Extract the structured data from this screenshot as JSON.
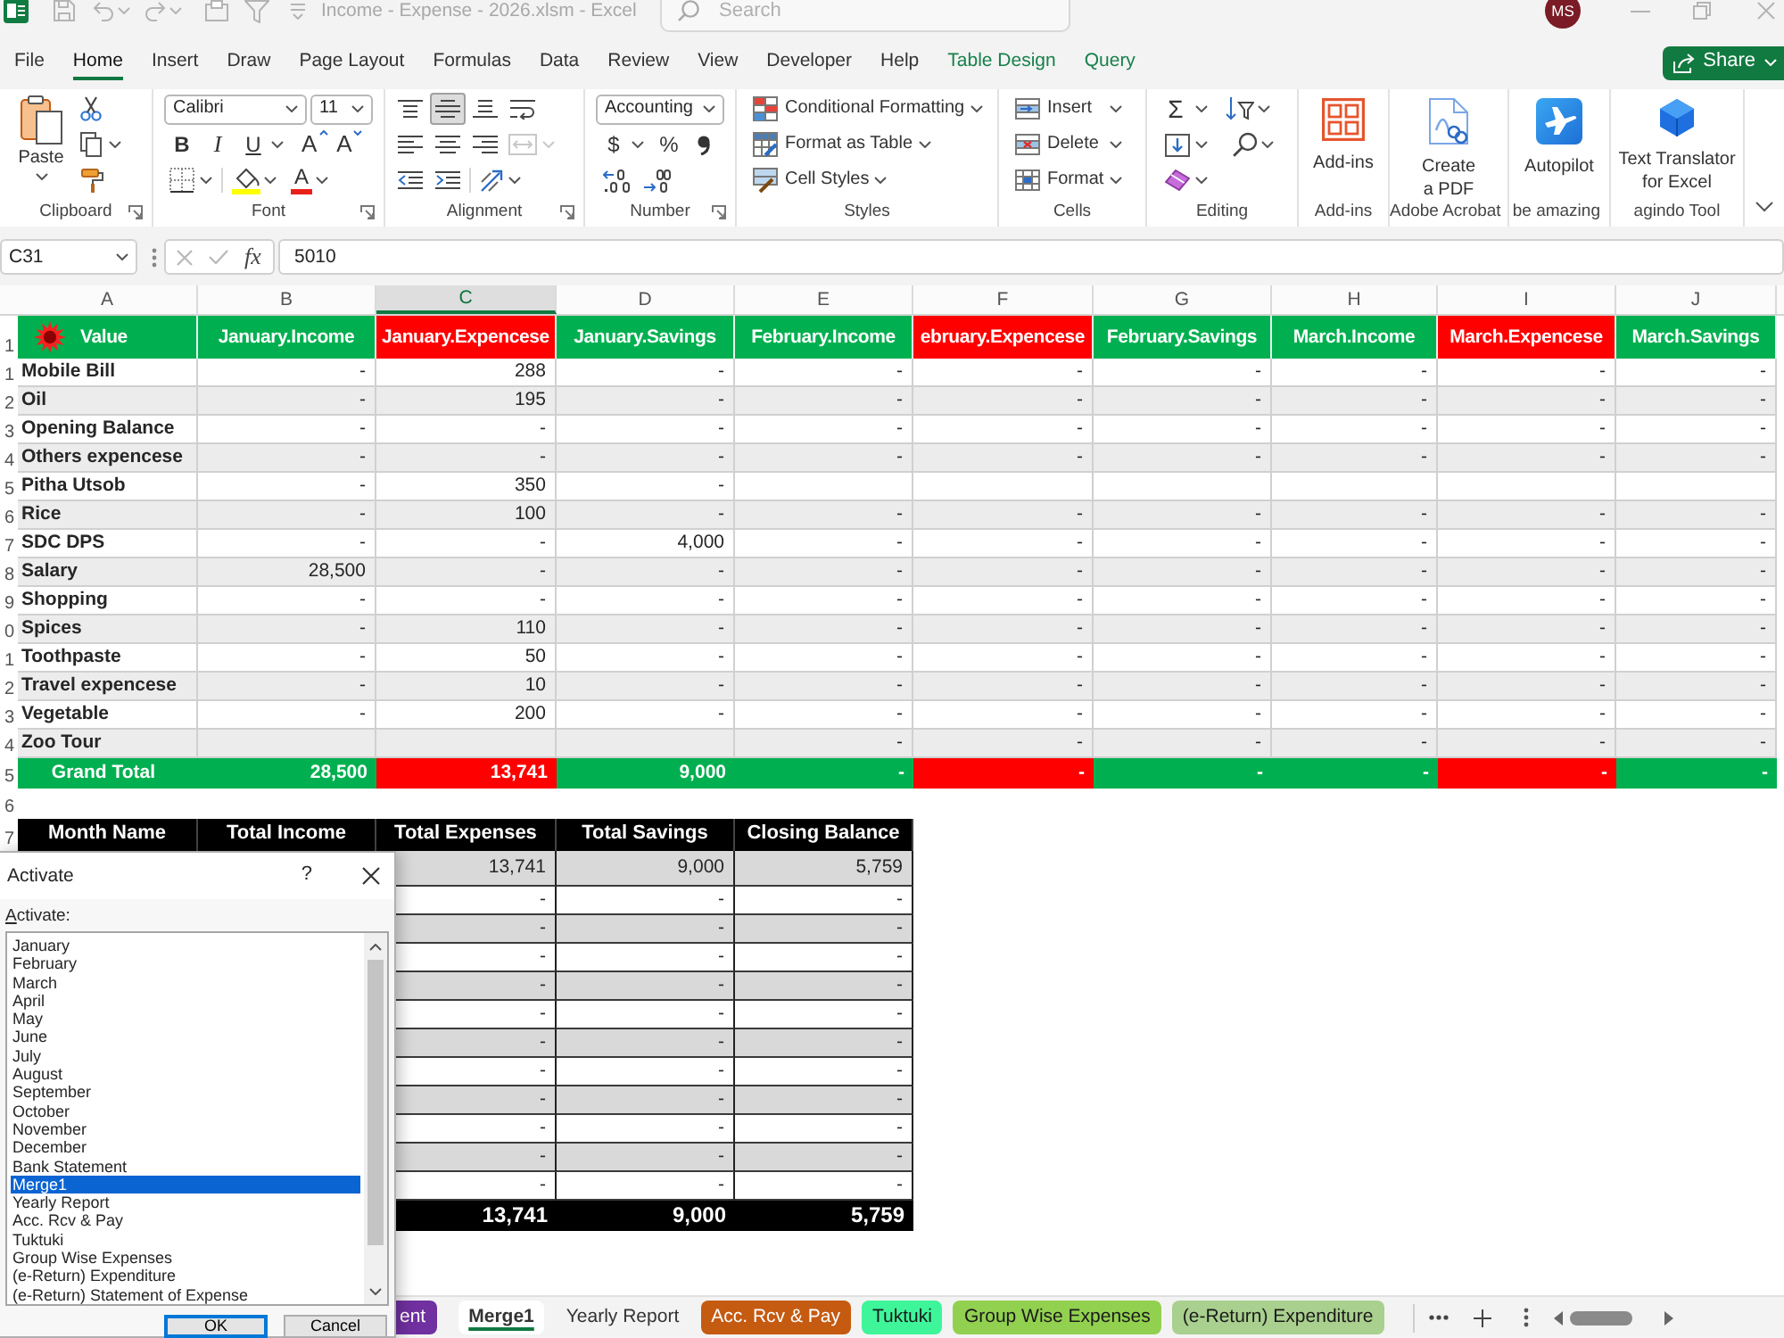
{
  "title_bar": {
    "title": "Income - Expense - 2026.xlsm - Excel",
    "search": {
      "placeholder": "Search"
    },
    "avatar": "MS"
  },
  "menu": {
    "tabs": [
      {
        "label": "File",
        "selected": false,
        "kind": "standard"
      },
      {
        "label": "Home",
        "selected": true,
        "kind": "standard"
      },
      {
        "label": "Insert",
        "selected": false,
        "kind": "standard"
      },
      {
        "label": "Draw",
        "selected": false,
        "kind": "standard"
      },
      {
        "label": "Page Layout",
        "selected": false,
        "kind": "standard"
      },
      {
        "label": "Formulas",
        "selected": false,
        "kind": "standard"
      },
      {
        "label": "Data",
        "selected": false,
        "kind": "standard"
      },
      {
        "label": "Review",
        "selected": false,
        "kind": "standard"
      },
      {
        "label": "View",
        "selected": false,
        "kind": "standard"
      },
      {
        "label": "Developer",
        "selected": false,
        "kind": "standard"
      },
      {
        "label": "Help",
        "selected": false,
        "kind": "standard"
      },
      {
        "label": "Table Design",
        "selected": false,
        "kind": "contextual"
      },
      {
        "label": "Query",
        "selected": false,
        "kind": "contextual"
      }
    ],
    "share": "Share"
  },
  "ribbon": {
    "groups": [
      {
        "label": "Clipboard",
        "launcher": true
      },
      {
        "label": "Font",
        "launcher": true
      },
      {
        "label": "Alignment",
        "launcher": true
      },
      {
        "label": "Number",
        "launcher": true
      },
      {
        "label": "Styles",
        "launcher": false
      },
      {
        "label": "Cells",
        "launcher": false
      },
      {
        "label": "Editing",
        "launcher": false
      },
      {
        "label": "Add-ins",
        "launcher": false
      },
      {
        "label": "Adobe Acrobat",
        "launcher": false
      },
      {
        "label": "be amazing",
        "launcher": false
      },
      {
        "label": "agindo Tool",
        "launcher": false
      }
    ],
    "paste": "Paste",
    "font_name": "Calibri",
    "font_size": "11",
    "bold": "B",
    "italic": "I",
    "underline": "U",
    "grow_font": "A",
    "shrink_font": "A",
    "font_color": "A",
    "vertical_align": [
      {
        "selected": false
      },
      {
        "selected": true
      },
      {
        "selected": false
      }
    ],
    "merge_disabled": true,
    "number_format": "Accounting",
    "currency": "$",
    "percent": "%",
    "style_commands": [
      "Conditional Formatting",
      "Format as Table",
      "Cell Styles"
    ],
    "cell_commands": [
      "Insert",
      "Delete",
      "Format"
    ],
    "autosum": "Σ",
    "large_buttons": [
      "Add-ins",
      "Create a PDF",
      "Autopilot",
      "Text Translator for Excel"
    ]
  },
  "formula_bar": {
    "name_box": "C31",
    "fx": "fx",
    "formula": "5010"
  },
  "sheet": {
    "columns": [
      {
        "letter": "A",
        "selected": false
      },
      {
        "letter": "B",
        "selected": false
      },
      {
        "letter": "C",
        "selected": true
      },
      {
        "letter": "D",
        "selected": false
      },
      {
        "letter": "E",
        "selected": false
      },
      {
        "letter": "F",
        "selected": false
      },
      {
        "letter": "G",
        "selected": false
      },
      {
        "letter": "H",
        "selected": false
      },
      {
        "letter": "I",
        "selected": false
      },
      {
        "letter": "J",
        "selected": false
      }
    ],
    "header_row": {
      "row_number": "1",
      "cells": [
        {
          "text": "Value",
          "color": "#00b050"
        },
        {
          "text": "January.Income",
          "color": "#00b050"
        },
        {
          "text": "January.Expencese",
          "color": "#ff0000"
        },
        {
          "text": "January.Savings",
          "color": "#00b050"
        },
        {
          "text": "February.Income",
          "color": "#00b050"
        },
        {
          "text": "ebruary.Expencese",
          "color": "#ff0000"
        },
        {
          "text": "February.Savings",
          "color": "#00b050"
        },
        {
          "text": "March.Income",
          "color": "#00b050"
        },
        {
          "text": "March.Expencese",
          "color": "#ff0000"
        },
        {
          "text": "March.Savings",
          "color": "#00b050"
        }
      ]
    },
    "rows": [
      {
        "row_number": "1",
        "label": "Mobile Bill",
        "kind": "full",
        "values": [
          "-",
          "288",
          "-",
          "-",
          "-",
          "-",
          "-",
          "-",
          "-"
        ]
      },
      {
        "row_number": "2",
        "label": "Oil",
        "kind": "full",
        "values": [
          "-",
          "195",
          "-",
          "-",
          "-",
          "-",
          "-",
          "-",
          "-"
        ]
      },
      {
        "row_number": "3",
        "label": "Opening Balance",
        "kind": "full",
        "values": [
          "-",
          "-",
          "-",
          "-",
          "-",
          "-",
          "-",
          "-",
          "-"
        ]
      },
      {
        "row_number": "4",
        "label": "Others expencese",
        "kind": "full",
        "values": [
          "-",
          "-",
          "-",
          "-",
          "-",
          "-",
          "-",
          "-",
          "-"
        ]
      },
      {
        "row_number": "5",
        "label": "Pitha Utsob",
        "kind": "leading",
        "values": [
          "-",
          "350",
          "-"
        ]
      },
      {
        "row_number": "6",
        "label": "Rice",
        "kind": "full",
        "values": [
          "-",
          "100",
          "-",
          "-",
          "-",
          "-",
          "-",
          "-",
          "-"
        ]
      },
      {
        "row_number": "7",
        "label": "SDC DPS",
        "kind": "full",
        "values": [
          "-",
          "-",
          "4,000",
          "-",
          "-",
          "-",
          "-",
          "-",
          "-"
        ]
      },
      {
        "row_number": "8",
        "label": "Salary",
        "kind": "full",
        "values": [
          "28,500",
          "-",
          "-",
          "-",
          "-",
          "-",
          "-",
          "-",
          "-"
        ]
      },
      {
        "row_number": "9",
        "label": "Shopping",
        "kind": "full",
        "values": [
          "-",
          "-",
          "-",
          "-",
          "-",
          "-",
          "-",
          "-",
          "-"
        ]
      },
      {
        "row_number": "0",
        "label": "Spices",
        "kind": "full",
        "values": [
          "-",
          "110",
          "-",
          "-",
          "-",
          "-",
          "-",
          "-",
          "-"
        ]
      },
      {
        "row_number": "1",
        "label": "Toothpaste",
        "kind": "full",
        "values": [
          "-",
          "50",
          "-",
          "-",
          "-",
          "-",
          "-",
          "-",
          "-"
        ]
      },
      {
        "row_number": "2",
        "label": "Travel expencese",
        "kind": "full",
        "values": [
          "-",
          "10",
          "-",
          "-",
          "-",
          "-",
          "-",
          "-",
          "-"
        ]
      },
      {
        "row_number": "3",
        "label": "Vegetable",
        "kind": "full",
        "values": [
          "-",
          "200",
          "-",
          "-",
          "-",
          "-",
          "-",
          "-",
          "-"
        ]
      },
      {
        "row_number": "4",
        "label": "Zoo Tour",
        "kind": "trailing",
        "values": [
          "-",
          "-",
          "-",
          "-",
          "-",
          "-"
        ]
      }
    ],
    "total_row": {
      "row_number": "5",
      "label": "Grand Total",
      "values": [
        "28,500",
        "13,741",
        "9,000",
        "-",
        "-",
        "-",
        "-",
        "-",
        "-"
      ]
    },
    "blank_row": {
      "row_number": "6"
    },
    "summary": {
      "row_number": "7",
      "columns": [
        "Month Name",
        "Total Income",
        "Total Expenses",
        "Total Savings",
        "Closing Balance"
      ],
      "rows": [
        {
          "values": [
            "13,741",
            "9,000",
            "5,759"
          ]
        },
        {
          "values": [
            "-",
            "-",
            "-"
          ]
        },
        {
          "values": [
            "-",
            "-",
            "-"
          ]
        },
        {
          "values": [
            "-",
            "-",
            "-"
          ]
        },
        {
          "values": [
            "-",
            "-",
            "-"
          ]
        },
        {
          "values": [
            "-",
            "-",
            "-"
          ]
        },
        {
          "values": [
            "-",
            "-",
            "-"
          ]
        },
        {
          "values": [
            "-",
            "-",
            "-"
          ]
        },
        {
          "values": [
            "-",
            "-",
            "-"
          ]
        },
        {
          "values": [
            "-",
            "-",
            "-"
          ]
        },
        {
          "values": [
            "-",
            "-",
            "-"
          ]
        },
        {
          "values": [
            "-",
            "-",
            "-"
          ]
        }
      ],
      "total": {
        "values": [
          "13,741",
          "9,000",
          "5,759"
        ]
      }
    }
  },
  "dialog": {
    "title": "Activate",
    "help": "?",
    "label": "Activate:",
    "items": [
      {
        "label": "January",
        "selected": false
      },
      {
        "label": "February",
        "selected": false
      },
      {
        "label": "March",
        "selected": false
      },
      {
        "label": "April",
        "selected": false
      },
      {
        "label": "May",
        "selected": false
      },
      {
        "label": "June",
        "selected": false
      },
      {
        "label": "July",
        "selected": false
      },
      {
        "label": "August",
        "selected": false
      },
      {
        "label": "September",
        "selected": false
      },
      {
        "label": "October",
        "selected": false
      },
      {
        "label": "November",
        "selected": false
      },
      {
        "label": "December",
        "selected": false
      },
      {
        "label": "Bank Statement",
        "selected": false
      },
      {
        "label": "Merge1",
        "selected": true
      },
      {
        "label": "Yearly Report",
        "selected": false
      },
      {
        "label": "Acc. Rcv & Pay",
        "selected": false
      },
      {
        "label": "Tuktuki",
        "selected": false
      },
      {
        "label": "Group Wise Expenses",
        "selected": false
      },
      {
        "label": "(e-Return) Expenditure",
        "selected": false
      },
      {
        "label": "(e-Return) Statement of Expense",
        "selected": false
      }
    ],
    "buttons": [
      "OK",
      "Cancel"
    ]
  },
  "sheet_tabs": [
    {
      "label": "ent",
      "selected": false,
      "color": "#7030a0"
    },
    {
      "label": "Merge1",
      "selected": true
    },
    {
      "label": "Yearly Report",
      "selected": false
    },
    {
      "label": "Acc. Rcv & Pay",
      "selected": false,
      "color": "#c55a11"
    },
    {
      "label": "Tuktuki",
      "selected": false,
      "color": "#3ef59a"
    },
    {
      "label": "Group Wise Expenses",
      "selected": false,
      "color": "#92d050"
    },
    {
      "label": "(e-Return) Expenditure",
      "selected": false,
      "color": "#a9d08e"
    }
  ]
}
